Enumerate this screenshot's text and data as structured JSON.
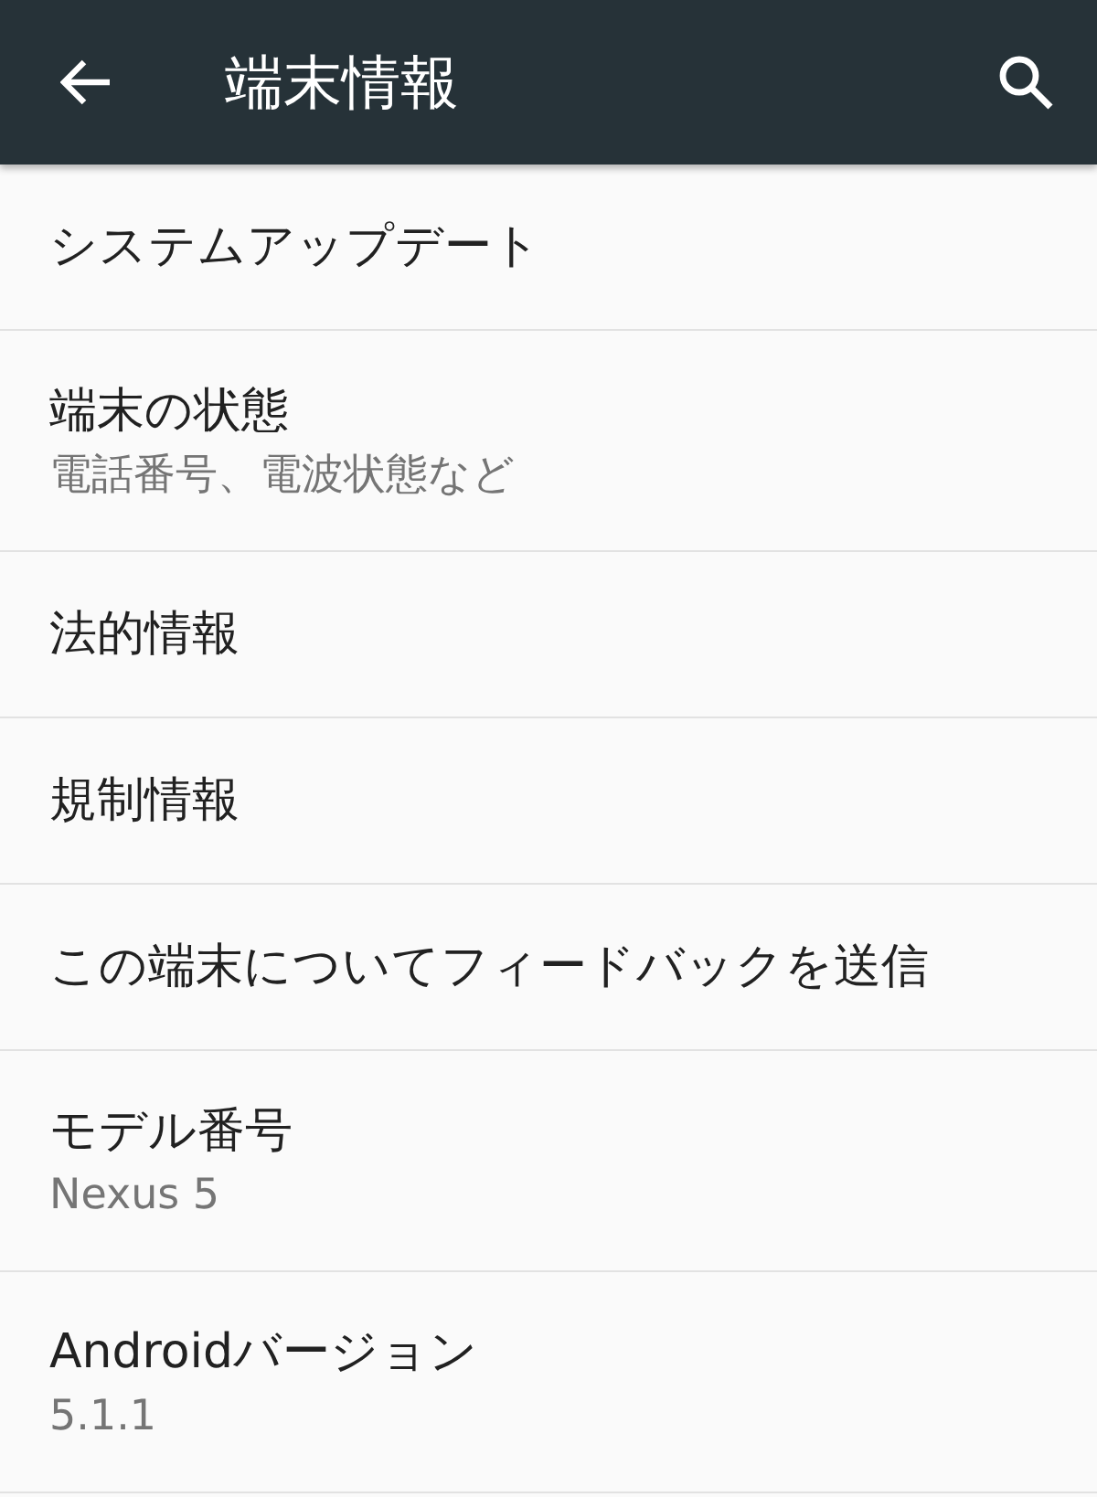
{
  "app_bar": {
    "title": "端末情報"
  },
  "items": [
    {
      "title": "システムアップデート"
    },
    {
      "title": "端末の状態",
      "summary": "電話番号、電波状態など"
    },
    {
      "title": "法的情報"
    },
    {
      "title": "規制情報"
    },
    {
      "title": "この端末についてフィードバックを送信"
    },
    {
      "title": "モデル番号",
      "summary": "Nexus 5"
    },
    {
      "title": "Androidバージョン",
      "summary": "5.1.1"
    }
  ]
}
